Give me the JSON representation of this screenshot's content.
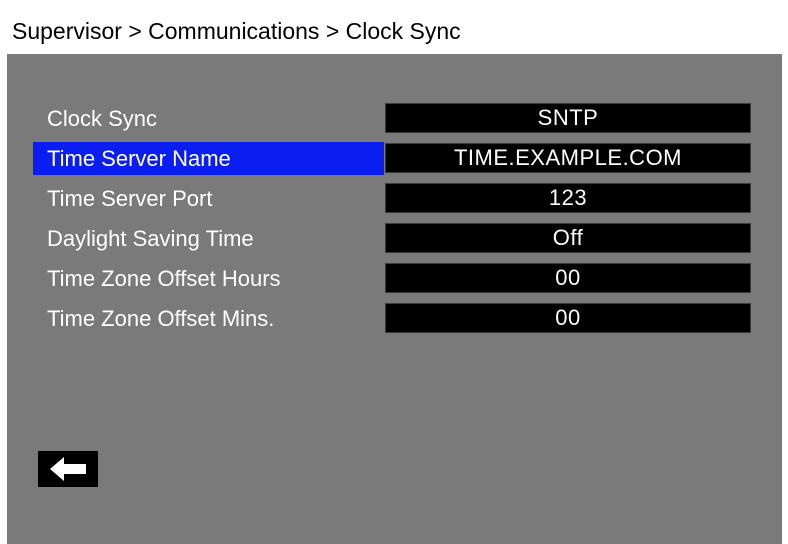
{
  "header": {
    "breadcrumb": "Supervisor > Communications > Clock Sync"
  },
  "settings": [
    {
      "label": "Clock Sync",
      "value": "SNTP",
      "selected": false
    },
    {
      "label": "Time Server Name",
      "value": "TIME.EXAMPLE.COM",
      "selected": true
    },
    {
      "label": "Time Server Port",
      "value": "123",
      "selected": false
    },
    {
      "label": "Daylight Saving Time",
      "value": "Off",
      "selected": false
    },
    {
      "label": "Time Zone Offset Hours",
      "value": "00",
      "selected": false
    },
    {
      "label": "Time Zone Offset Mins.",
      "value": "00",
      "selected": false
    }
  ],
  "colors": {
    "panel_background": "#7a7a7a",
    "selected_highlight": "#0a1ef2",
    "value_box": "#000000"
  },
  "footer": {
    "back_icon": "arrow-left-icon"
  }
}
